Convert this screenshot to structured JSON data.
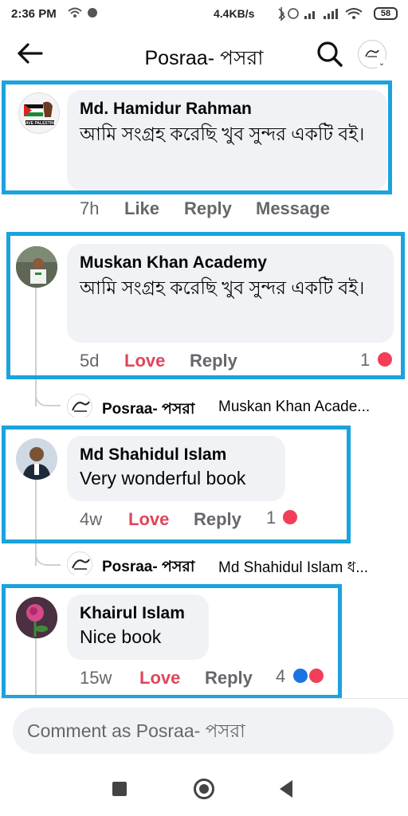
{
  "status_bar": {
    "time": "2:36 PM",
    "network_speed": "4.4KB/s",
    "battery": "58"
  },
  "header": {
    "title": "Posraa- পসরা"
  },
  "comments": [
    {
      "author": "Md. Hamidur Rahman",
      "text": "আমি সংগ্রহ করেছি খুব সুন্দর একটি বই।",
      "time": "7h",
      "reaction_action": "Like",
      "reply_action": "Reply",
      "extra_action": "Message"
    },
    {
      "author": "Muskan Khan Academy",
      "text": "আমি সংগ্রহ করেছি খুব সুন্দর একটি বই।",
      "time": "5d",
      "reaction_action": "Love",
      "reply_action": "Reply",
      "reaction_count": "1"
    },
    {
      "author": "Md Shahidul Islam",
      "text": "Very wonderful book",
      "time": "4w",
      "reaction_action": "Love",
      "reply_action": "Reply",
      "reaction_count": "1"
    },
    {
      "author": "Khairul Islam",
      "text": "Nice book",
      "time": "15w",
      "reaction_action": "Love",
      "reply_action": "Reply",
      "reaction_count": "4"
    }
  ],
  "replies": [
    {
      "author": "Posraa- পসরা",
      "preview": "Muskan Khan Acade..."
    },
    {
      "author": "Posraa- পসরা",
      "preview": "Md Shahidul Islam ধ..."
    }
  ],
  "avatar_labels": {
    "palestine": "SAVE PALESTINE"
  },
  "composer": {
    "placeholder": "Comment as Posraa- পসরা"
  },
  "colors": {
    "highlight": "#1aa3dd",
    "love": "#e0455a",
    "bubble": "#f0f2f5",
    "meta": "#65676b"
  }
}
